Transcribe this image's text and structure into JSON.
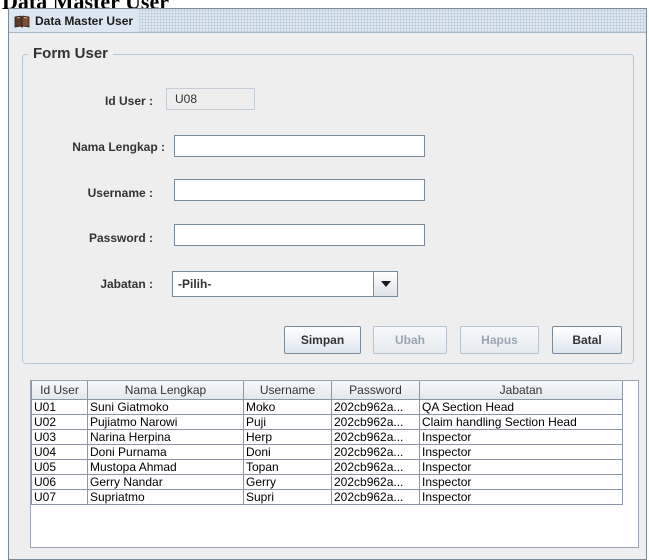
{
  "page_heading": "Data Master User",
  "window": {
    "title": "Data Master User"
  },
  "form": {
    "legend": "Form User",
    "id_label": "Id User :",
    "id_value": "U08",
    "nama_label": "Nama Lengkap :",
    "nama_value": "",
    "username_label": "Username :",
    "username_value": "",
    "password_label": "Password :",
    "password_value": "",
    "jabatan_label": "Jabatan :",
    "jabatan_selected": "-Pilih-"
  },
  "buttons": {
    "simpan": {
      "label": "Simpan",
      "enabled": true
    },
    "ubah": {
      "label": "Ubah",
      "enabled": false
    },
    "hapus": {
      "label": "Hapus",
      "enabled": false
    },
    "batal": {
      "label": "Batal",
      "enabled": true
    }
  },
  "table": {
    "columns": [
      "Id User",
      "Nama Lengkap",
      "Username",
      "Password",
      "Jabatan"
    ],
    "rows": [
      [
        "U01",
        "Suni Giatmoko",
        "Moko",
        "202cb962a...",
        "QA Section Head"
      ],
      [
        "U02",
        "Pujiatmo Narowi",
        "Puji",
        "202cb962a...",
        "Claim handling Section Head"
      ],
      [
        "U03",
        "Narina Herpina",
        "Herp",
        "202cb962a...",
        "Inspector"
      ],
      [
        "U04",
        "Doni Purnama",
        "Doni",
        "202cb962a...",
        "Inspector"
      ],
      [
        "U05",
        "Mustopa Ahmad",
        "Topan",
        "202cb962a...",
        "Inspector"
      ],
      [
        "U06",
        "Gerry Nandar",
        "Gerry",
        "202cb962a...",
        "Inspector"
      ],
      [
        "U07",
        "Supriatmo",
        "Supri",
        "202cb962a...",
        "Inspector"
      ]
    ]
  },
  "icons": {
    "window_icon": "book-icon",
    "dropdown_icon": "chevron-down-icon"
  }
}
